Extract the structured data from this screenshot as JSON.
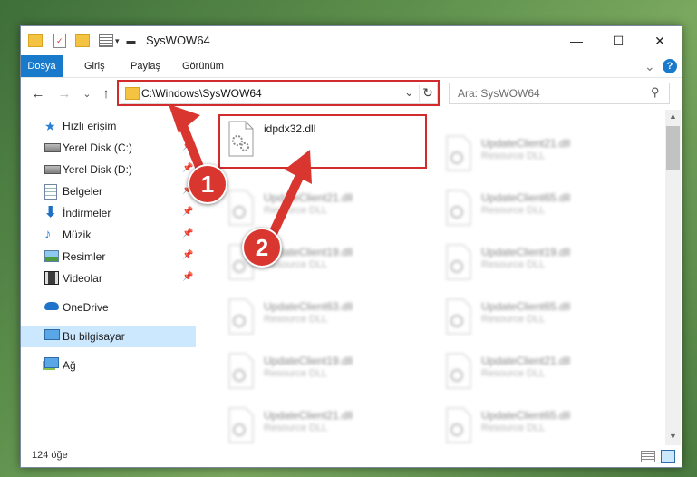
{
  "window": {
    "title": "SysWOW64",
    "controls": {
      "minimize": "—",
      "maximize": "☐",
      "close": "✕"
    }
  },
  "ribbon": {
    "tabs": [
      "Dosya",
      "Giriş",
      "Paylaş",
      "Görünüm"
    ],
    "expand_glyph": "⌄",
    "help_glyph": "?"
  },
  "navigation": {
    "back_glyph": "←",
    "forward_glyph": "→",
    "recent_glyph": "⌄",
    "up_glyph": "↑",
    "address": "C:\\Windows\\SysWOW64",
    "address_dropdown_glyph": "⌄",
    "refresh_glyph": "↻",
    "search_placeholder": "Ara: SysWOW64",
    "search_glyph": "⚲"
  },
  "sidebar": {
    "items": [
      {
        "label": "Hızlı erişim",
        "icon": "star-icon",
        "pinned": false
      },
      {
        "label": "Yerel Disk (C:)",
        "icon": "drive-icon",
        "pinned": true
      },
      {
        "label": "Yerel Disk (D:)",
        "icon": "drive-icon",
        "pinned": true
      },
      {
        "label": "Belgeler",
        "icon": "documents-icon",
        "pinned": true
      },
      {
        "label": "İndirmeler",
        "icon": "download-icon",
        "pinned": true
      },
      {
        "label": "Müzik",
        "icon": "music-icon",
        "pinned": true
      },
      {
        "label": "Resimler",
        "icon": "pictures-icon",
        "pinned": true
      },
      {
        "label": "Videolar",
        "icon": "videos-icon",
        "pinned": true
      },
      {
        "label": "OneDrive",
        "icon": "cloud-icon",
        "pinned": false
      },
      {
        "label": "Bu bilgisayar",
        "icon": "computer-icon",
        "pinned": false,
        "selected": true
      },
      {
        "label": "Ağ",
        "icon": "network-icon",
        "pinned": false
      }
    ],
    "pin_glyph": "📌"
  },
  "files": {
    "highlighted": {
      "name": "idpdx32.dll",
      "type": ""
    },
    "left_column": [
      {
        "name": "UpdateClient21.dll",
        "type": "Resource DLL"
      },
      {
        "name": "UpdateClient19.dll",
        "type": "Resource DLL"
      },
      {
        "name": "UpdateClient63.dll",
        "type": "Resource DLL"
      },
      {
        "name": "UpdateClient19.dll",
        "type": "Resource DLL"
      },
      {
        "name": "UpdateClient21.dll",
        "type": "Resource DLL"
      }
    ],
    "right_column": [
      {
        "name": "UpdateClient21.dll",
        "type": "Resource DLL"
      },
      {
        "name": "UpdateClient65.dll",
        "type": "Resource DLL"
      },
      {
        "name": "UpdateClient19.dll",
        "type": "Resource DLL"
      },
      {
        "name": "UpdateClient65.dll",
        "type": "Resource DLL"
      },
      {
        "name": "UpdateClient21.dll",
        "type": "Resource DLL"
      },
      {
        "name": "UpdateClient65.dll",
        "type": "Resource DLL"
      }
    ]
  },
  "status": {
    "item_count": "124 öğe"
  },
  "annotations": {
    "step1": "1",
    "step2": "2",
    "highlight_color": "#d12b2b",
    "badge_color": "#d9362f"
  },
  "colors": {
    "accent": "#1979ca",
    "selected": "#cce8ff",
    "folder": "#f5c342"
  }
}
